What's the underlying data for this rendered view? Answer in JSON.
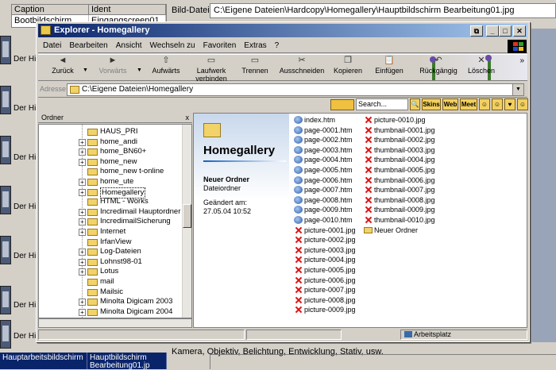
{
  "background": {
    "grid": {
      "headers": [
        "Caption",
        "Ident"
      ],
      "row": [
        "Bootbildschirm",
        "Eingangscreen01"
      ]
    },
    "row_label": "Der Hi",
    "bilddatei_label": "Bild-Datei",
    "bilddatei_path": "C:\\Eigene Dateien\\Hardcopy\\Homegallery\\Hauptbildschirm Bearbeitung01.jpg",
    "bottom_text": "Kamera, Objektiv, Belichtung, Entwicklung, Stativ, usw.",
    "selected_row": [
      "Hauptarbeitsbildschirm",
      "Hauptbildschirm Bearbeitung01.jp"
    ]
  },
  "window": {
    "title": "Explorer - Homegallery",
    "title_buttons": [
      "⧉",
      "_",
      "□",
      "✕"
    ],
    "menu": [
      "Datei",
      "Bearbeiten",
      "Ansicht",
      "Wechseln zu",
      "Favoriten",
      "Extras",
      "?"
    ],
    "toolbar": [
      {
        "label": "Zurück",
        "icon": "back-arrow-icon",
        "glyph": "◄"
      },
      {
        "label": "Vorwärts",
        "icon": "forward-arrow-icon",
        "glyph": "►"
      },
      {
        "label": "Aufwärts",
        "icon": "up-folder-icon",
        "glyph": "⇧"
      },
      {
        "label": "Laufwerk verbinden",
        "icon": "map-drive-icon",
        "glyph": "▭"
      },
      {
        "label": "Trennen",
        "icon": "disconnect-drive-icon",
        "glyph": "▭"
      },
      {
        "label": "Ausschneiden",
        "icon": "scissors-icon",
        "glyph": "✂"
      },
      {
        "label": "Kopieren",
        "icon": "copy-icon",
        "glyph": "❐"
      },
      {
        "label": "Einfügen",
        "icon": "paste-icon",
        "glyph": "📋"
      },
      {
        "label": "Rückgängig",
        "icon": "undo-icon",
        "glyph": "↶"
      },
      {
        "label": "Löschen",
        "icon": "delete-icon",
        "glyph": "✕"
      }
    ],
    "toolbar_more": "»",
    "address_label": "Adresse",
    "address_value": "C:\\Eigene Dateien\\Homegallery",
    "search_placeholder": "Search...",
    "search_buttons": [
      "Skins",
      "Web",
      "Meet"
    ],
    "folders_title": "Ordner",
    "folders_close": "x",
    "tree": [
      {
        "label": "HAUS_PRI",
        "expand": ""
      },
      {
        "label": "home_andi",
        "expand": "+"
      },
      {
        "label": "home_BN60+",
        "expand": "+"
      },
      {
        "label": "home_new",
        "expand": "+"
      },
      {
        "label": "home_new t-online",
        "expand": ""
      },
      {
        "label": "home_ute",
        "expand": "+"
      },
      {
        "label": "Homegallery",
        "expand": "+",
        "selected": true
      },
      {
        "label": "HTML - Works",
        "expand": ""
      },
      {
        "label": "Incredimail Hauptordner",
        "expand": "+"
      },
      {
        "label": "IncredimailSicherung",
        "expand": "+"
      },
      {
        "label": "Internet",
        "expand": "+"
      },
      {
        "label": "IrfanView",
        "expand": ""
      },
      {
        "label": "Log-Dateien",
        "expand": "+"
      },
      {
        "label": "Lohnst98-01",
        "expand": "+"
      },
      {
        "label": "Lotus",
        "expand": "+"
      },
      {
        "label": "mail",
        "expand": ""
      },
      {
        "label": "Mailsic",
        "expand": ""
      },
      {
        "label": "Minolta Digicam 2003",
        "expand": "+"
      },
      {
        "label": "Minolta Digicam 2004",
        "expand": "+"
      }
    ],
    "webview": {
      "title": "Homegallery",
      "type_name": "Neuer Ordner",
      "type_desc": "Dateiordner",
      "changed_label": "Geändert am:",
      "changed_value": "27.05.04 10:52"
    },
    "files_col1": [
      {
        "name": "index.htm",
        "type": "htm"
      },
      {
        "name": "page-0001.htm",
        "type": "htm"
      },
      {
        "name": "page-0002.htm",
        "type": "htm"
      },
      {
        "name": "page-0003.htm",
        "type": "htm"
      },
      {
        "name": "page-0004.htm",
        "type": "htm"
      },
      {
        "name": "page-0005.htm",
        "type": "htm"
      },
      {
        "name": "page-0006.htm",
        "type": "htm"
      },
      {
        "name": "page-0007.htm",
        "type": "htm"
      },
      {
        "name": "page-0008.htm",
        "type": "htm"
      },
      {
        "name": "page-0009.htm",
        "type": "htm"
      },
      {
        "name": "page-0010.htm",
        "type": "htm"
      },
      {
        "name": "picture-0001.jpg",
        "type": "jpg"
      },
      {
        "name": "picture-0002.jpg",
        "type": "jpg"
      },
      {
        "name": "picture-0003.jpg",
        "type": "jpg"
      },
      {
        "name": "picture-0004.jpg",
        "type": "jpg"
      },
      {
        "name": "picture-0005.jpg",
        "type": "jpg"
      },
      {
        "name": "picture-0006.jpg",
        "type": "jpg"
      },
      {
        "name": "picture-0007.jpg",
        "type": "jpg"
      },
      {
        "name": "picture-0008.jpg",
        "type": "jpg"
      },
      {
        "name": "picture-0009.jpg",
        "type": "jpg"
      }
    ],
    "files_col2": [
      {
        "name": "picture-0010.jpg",
        "type": "jpg"
      },
      {
        "name": "thumbnail-0001.jpg",
        "type": "jpg"
      },
      {
        "name": "thumbnail-0002.jpg",
        "type": "jpg"
      },
      {
        "name": "thumbnail-0003.jpg",
        "type": "jpg"
      },
      {
        "name": "thumbnail-0004.jpg",
        "type": "jpg"
      },
      {
        "name": "thumbnail-0005.jpg",
        "type": "jpg"
      },
      {
        "name": "thumbnail-0006.jpg",
        "type": "jpg"
      },
      {
        "name": "thumbnail-0007.jpg",
        "type": "jpg"
      },
      {
        "name": "thumbnail-0008.jpg",
        "type": "jpg"
      },
      {
        "name": "thumbnail-0009.jpg",
        "type": "jpg"
      },
      {
        "name": "thumbnail-0010.jpg",
        "type": "jpg"
      },
      {
        "name": "Neuer Ordner",
        "type": "dir"
      }
    ],
    "status_location": "Arbeitsplatz"
  }
}
